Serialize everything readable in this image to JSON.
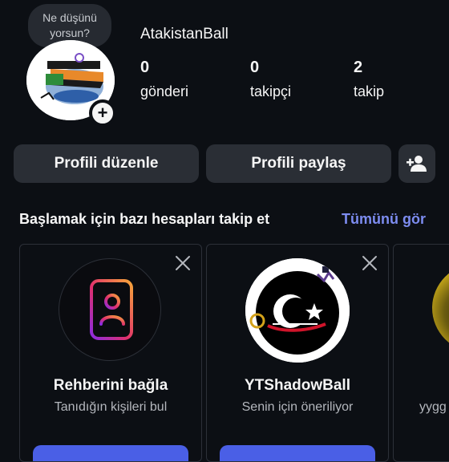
{
  "profile": {
    "note": [
      "Ne düşünü",
      "yorsun?"
    ],
    "username": "AtakistanBall",
    "stats": [
      {
        "value": "0",
        "label": "gönderi"
      },
      {
        "value": "0",
        "label": "takipçi"
      },
      {
        "value": "2",
        "label": "takip"
      }
    ],
    "add_icon": "+"
  },
  "actions": {
    "edit_label": "Profili düzenle",
    "share_label": "Profili paylaş",
    "add_person_icon": "person-add-icon"
  },
  "suggestions": {
    "title": "Başlamak için bazı hesapları takip et",
    "see_all": "Tümünü gör",
    "cards": [
      {
        "name": "Rehberini bağla",
        "sub": "Tanıdığın kişileri bul",
        "icon": "contacts-book-icon"
      },
      {
        "name": "YTShadowBall",
        "sub": "Senin için öneriliyor",
        "icon": "avatar"
      },
      {
        "name": "",
        "sub": "yygg",
        "icon": "avatar"
      }
    ]
  },
  "colors": {
    "background": "#0c0f14",
    "button": "#2a2e35",
    "accent_link": "#7d8cf0",
    "primary_button": "#4a5fe6"
  }
}
